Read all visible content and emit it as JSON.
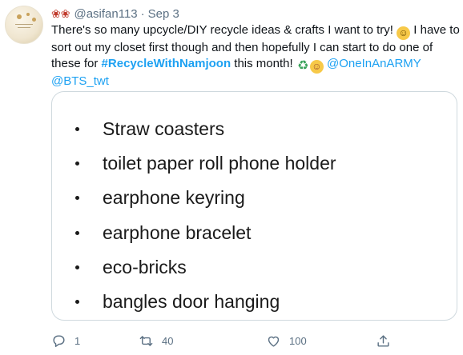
{
  "tweet": {
    "header": {
      "emoji_icon": "fallen-leaves-icon",
      "handle": "@asifan113",
      "separator": "·",
      "date": "Sep 3"
    },
    "text": {
      "part1": "There's so many upcycle/DIY recycle ideas & crafts I want to try! ",
      "part2": " I have to sort out my closet first though and then hopefully I can start to do one of these for ",
      "hashtag": "#RecycleWithNamjoon",
      "part3": " this month! ",
      "mention1": "@OneInAnARMY",
      "mention2": "@BTS_twt"
    },
    "image_card": {
      "items": [
        "Straw coasters",
        "toilet paper roll phone holder",
        "earphone keyring",
        "earphone bracelet",
        "eco-bricks",
        "bangles door hanging"
      ]
    },
    "actions": {
      "reply_count": "1",
      "retweet_count": "40",
      "like_count": "100"
    }
  },
  "colors": {
    "link": "#1da1f2",
    "muted": "#5b7083",
    "text": "#0f1419",
    "border": "#cfd9de"
  }
}
